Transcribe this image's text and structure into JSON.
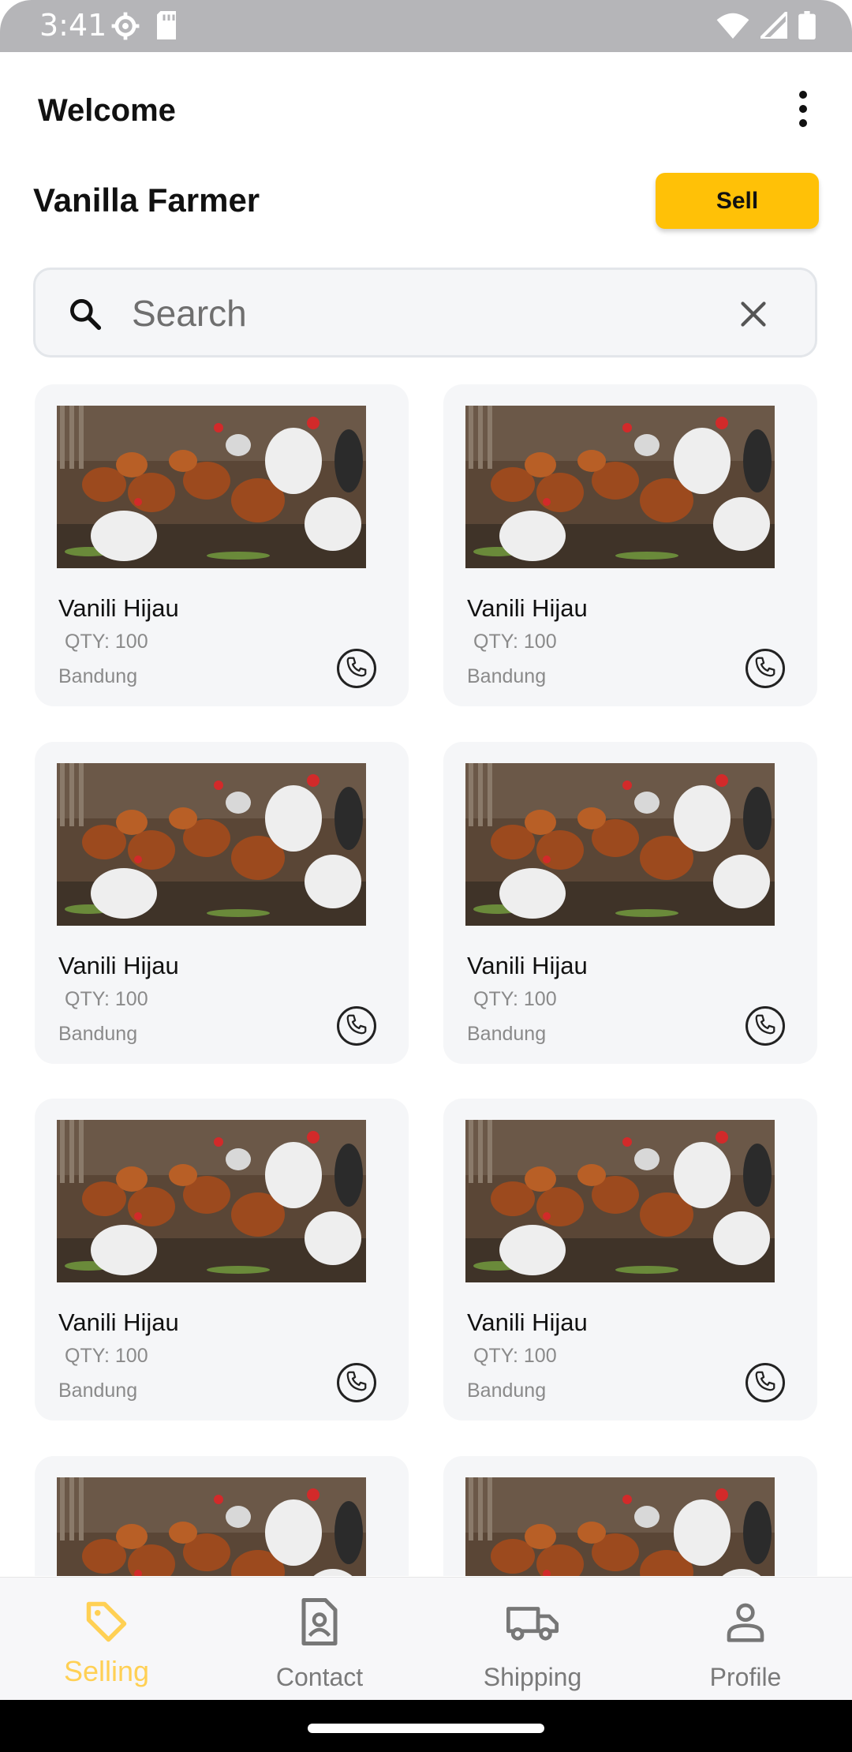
{
  "status_bar": {
    "time": "3:41",
    "left_icons": [
      "settings-icon",
      "sd-card-icon"
    ],
    "right_icons": [
      "wifi-icon",
      "signal-icon",
      "battery-icon"
    ]
  },
  "header": {
    "welcome": "Welcome",
    "farmer_name": "Vanilla Farmer",
    "sell_label": "Sell"
  },
  "search": {
    "placeholder": "Search",
    "value": ""
  },
  "products": [
    {
      "title": "Vanili Hijau",
      "qty": "QTY: 100",
      "location": "Bandung"
    },
    {
      "title": "Vanili Hijau",
      "qty": "QTY: 100",
      "location": "Bandung"
    },
    {
      "title": "Vanili Hijau",
      "qty": "QTY: 100",
      "location": "Bandung"
    },
    {
      "title": "Vanili Hijau",
      "qty": "QTY: 100",
      "location": "Bandung"
    },
    {
      "title": "Vanili Hijau",
      "qty": "QTY: 100",
      "location": "Bandung"
    },
    {
      "title": "Vanili Hijau",
      "qty": "QTY: 100",
      "location": "Bandung"
    },
    {
      "title": "",
      "qty": "",
      "location": ""
    },
    {
      "title": "",
      "qty": "",
      "location": ""
    }
  ],
  "bottom_nav": {
    "items": [
      {
        "label": "Selling",
        "icon": "tag-icon",
        "active": true
      },
      {
        "label": "Contact",
        "icon": "contact-card-icon",
        "active": false
      },
      {
        "label": "Shipping",
        "icon": "truck-icon",
        "active": false
      },
      {
        "label": "Profile",
        "icon": "person-icon",
        "active": false
      }
    ]
  },
  "colors": {
    "accent": "#ffc107",
    "active_nav": "#ffd054",
    "card_bg": "#f5f6f8",
    "muted_text": "#8a8a8a"
  }
}
